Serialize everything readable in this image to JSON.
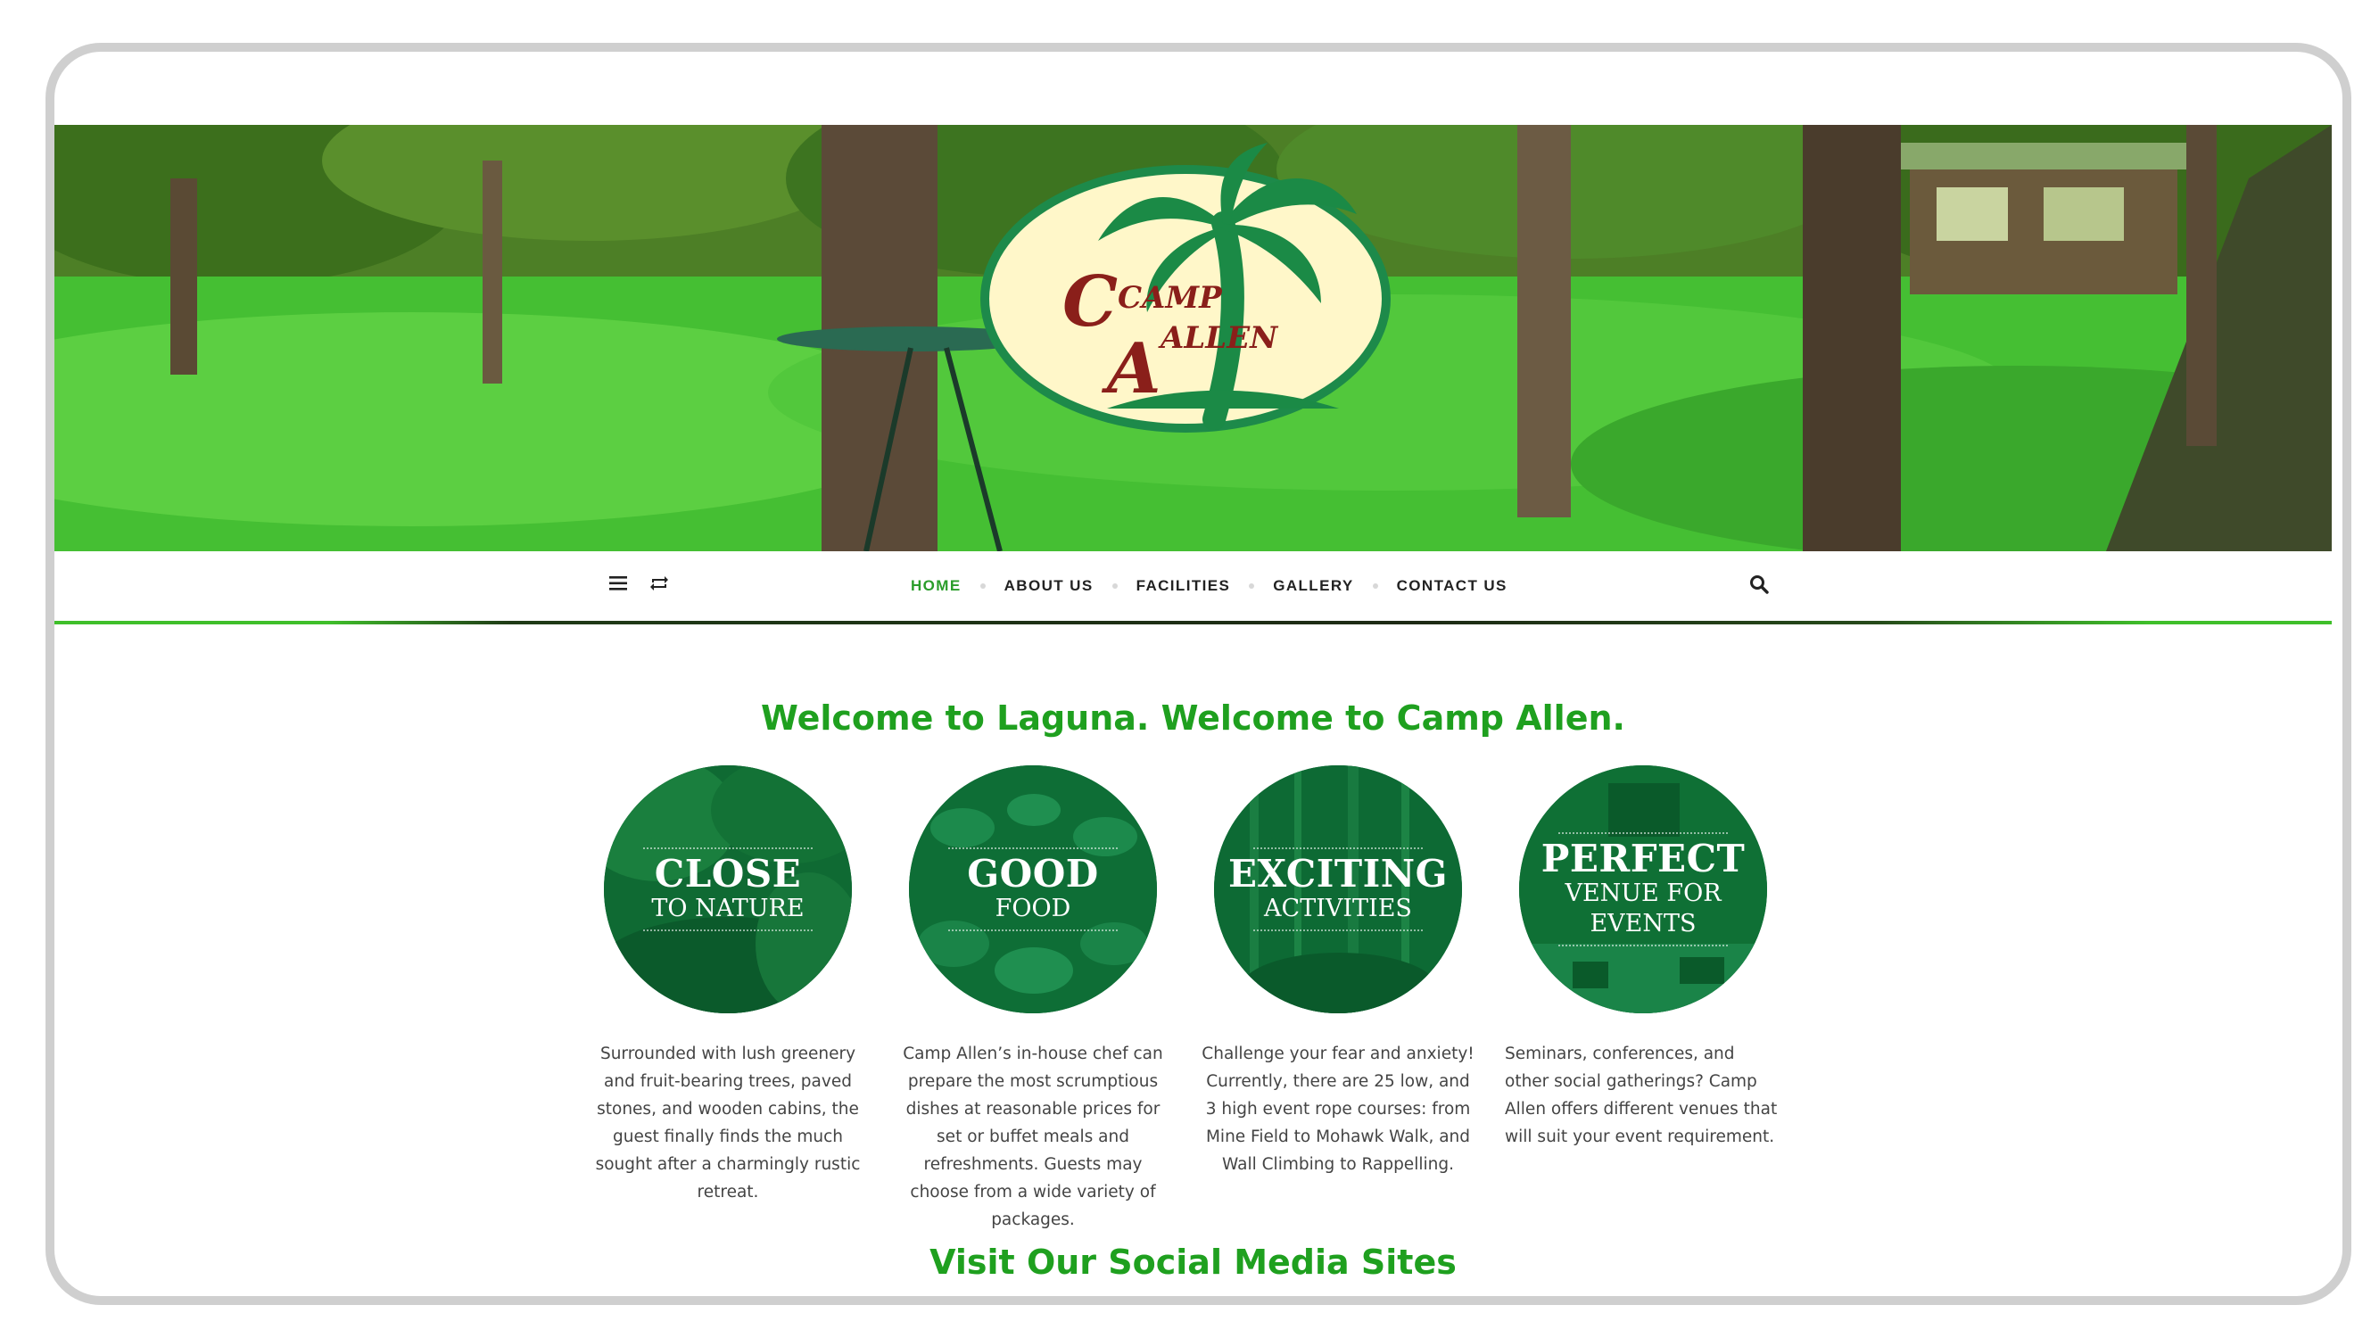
{
  "logo": {
    "text_line1": "CAMP",
    "text_line2": "ALLEN"
  },
  "nav": {
    "items": [
      "HOME",
      "ABOUT US",
      "FACILITIES",
      "GALLERY",
      "CONTACT US"
    ],
    "active_item": "HOME"
  },
  "welcome_heading": "Welcome to Laguna. Welcome to Camp Allen.",
  "features": [
    {
      "big": "CLOSE",
      "small": "TO NATURE",
      "description": "Surrounded with lush greenery and fruit-bearing trees, paved stones, and wooden cabins, the guest finally finds the much sought after a charmingly rustic retreat."
    },
    {
      "big": "GOOD",
      "small": "FOOD",
      "description": "Camp Allen’s in-house chef can prepare the most scrumptious dishes at reasonable prices for set or buffet meals and refreshments. Guests may choose from a wide variety of packages."
    },
    {
      "big": "EXCITING",
      "small": "ACTIVITIES",
      "description": "Challenge your fear and anxiety! Currently, there are 25 low, and 3 high event rope courses: from Mine Field to Mohawk Walk, and Wall Climbing to Rappelling."
    },
    {
      "big": "PERFECT",
      "small_line1": "VENUE FOR",
      "small_line2": "EVENTS",
      "description": "Seminars, conferences, and other social gatherings? Camp Allen offers different venues that will suit your event requirement."
    }
  ],
  "social_heading": "Visit Our Social Media Sites",
  "colors": {
    "accent_green": "#1fa01f",
    "nav_active": "#2a9d2a",
    "circle_green": "#0d6b34"
  },
  "icons": [
    "hamburger-menu-icon",
    "repeat-icon",
    "search-icon",
    "palm-tree-icon"
  ]
}
